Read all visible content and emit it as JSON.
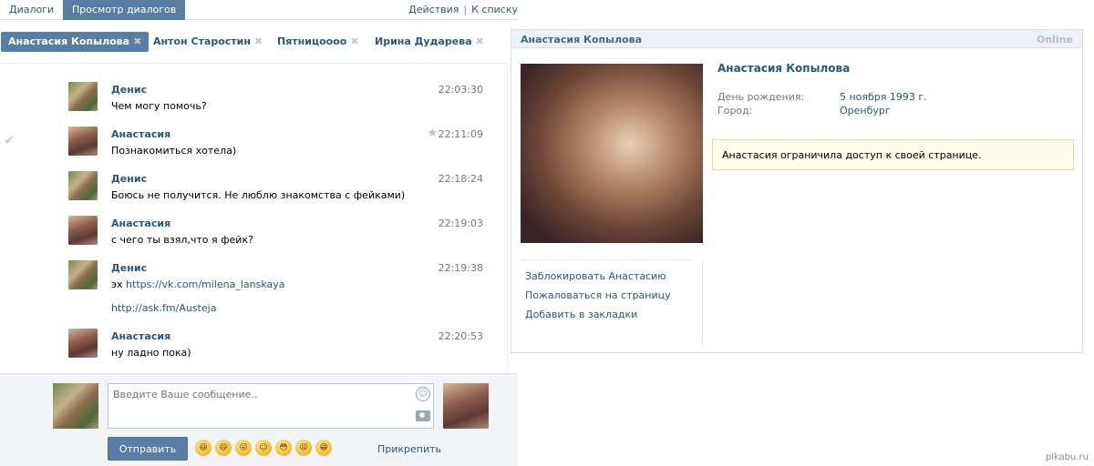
{
  "topnav": {
    "tab_dialogs": "Диалоги",
    "tab_view": "Просмотр диалогов",
    "actions": "Действия",
    "separator": "|",
    "to_list": "К списку"
  },
  "chat_tabs": [
    {
      "label": "Анастасия Копылова",
      "active": true
    },
    {
      "label": "Антон Старостин",
      "active": false
    },
    {
      "label": "Пятницоооо",
      "active": false
    },
    {
      "label": "Ирина Дударева",
      "active": false
    }
  ],
  "close_glyph": "✖",
  "messages": [
    {
      "author": "Денис",
      "time": "22:03:30",
      "text": "Чем могу помочь?",
      "avatar": "denis"
    },
    {
      "author": "Анастасия",
      "time": "22:11:09",
      "text": "Познакомиться хотела)",
      "avatar": "anastasia",
      "starred": true,
      "checked": true
    },
    {
      "author": "Денис",
      "time": "22:18:24",
      "text": "Боюсь не получится. Не люблю знакомства с фейками)",
      "avatar": "denis"
    },
    {
      "author": "Анастасия",
      "time": "22:19:03",
      "text": "с чего ты взял,что я фейк?",
      "avatar": "anastasia"
    },
    {
      "author": "Денис",
      "time": "22:19:38",
      "text_prefix": "эх ",
      "link1": "https://vk.com/milena_lanskaya",
      "link2": "http://ask.fm/Austeja",
      "avatar": "denis"
    },
    {
      "author": "Анастасия",
      "time": "22:20:53",
      "text": "ну ладно пока)",
      "avatar": "anastasia"
    }
  ],
  "icons": {
    "star": "star-icon",
    "check": "check-icon",
    "smile": "smile-icon",
    "camera": "camera-icon"
  },
  "glyphs": {
    "star": "★",
    "check": "✔",
    "smile": "☺"
  },
  "compose": {
    "placeholder": "Введите Ваше сообщение..",
    "send_label": "Отправить",
    "attach_label": "Прикрепить",
    "emojis": [
      "😆",
      "😄",
      "😜",
      "☺",
      "😳",
      "😫",
      "😁"
    ]
  },
  "profile": {
    "header_name": "Анастасия Копылова",
    "status": "Online",
    "name": "Анастасия Копылова",
    "birthday_label": "День рождения:",
    "birthday_value": "5 ноября 1993 г.",
    "city_label": "Город:",
    "city_value": "Оренбург",
    "notice": "Анастасия ограничила доступ к своей странице.",
    "actions": [
      "Заблокировать Анастасию",
      "Пожаловаться на страницу",
      "Добавить в закладки"
    ]
  },
  "watermark": "pikabu.ru",
  "colors": {
    "accent": "#597da3",
    "link": "#2b587a",
    "notice_bg": "#fefbe8"
  }
}
